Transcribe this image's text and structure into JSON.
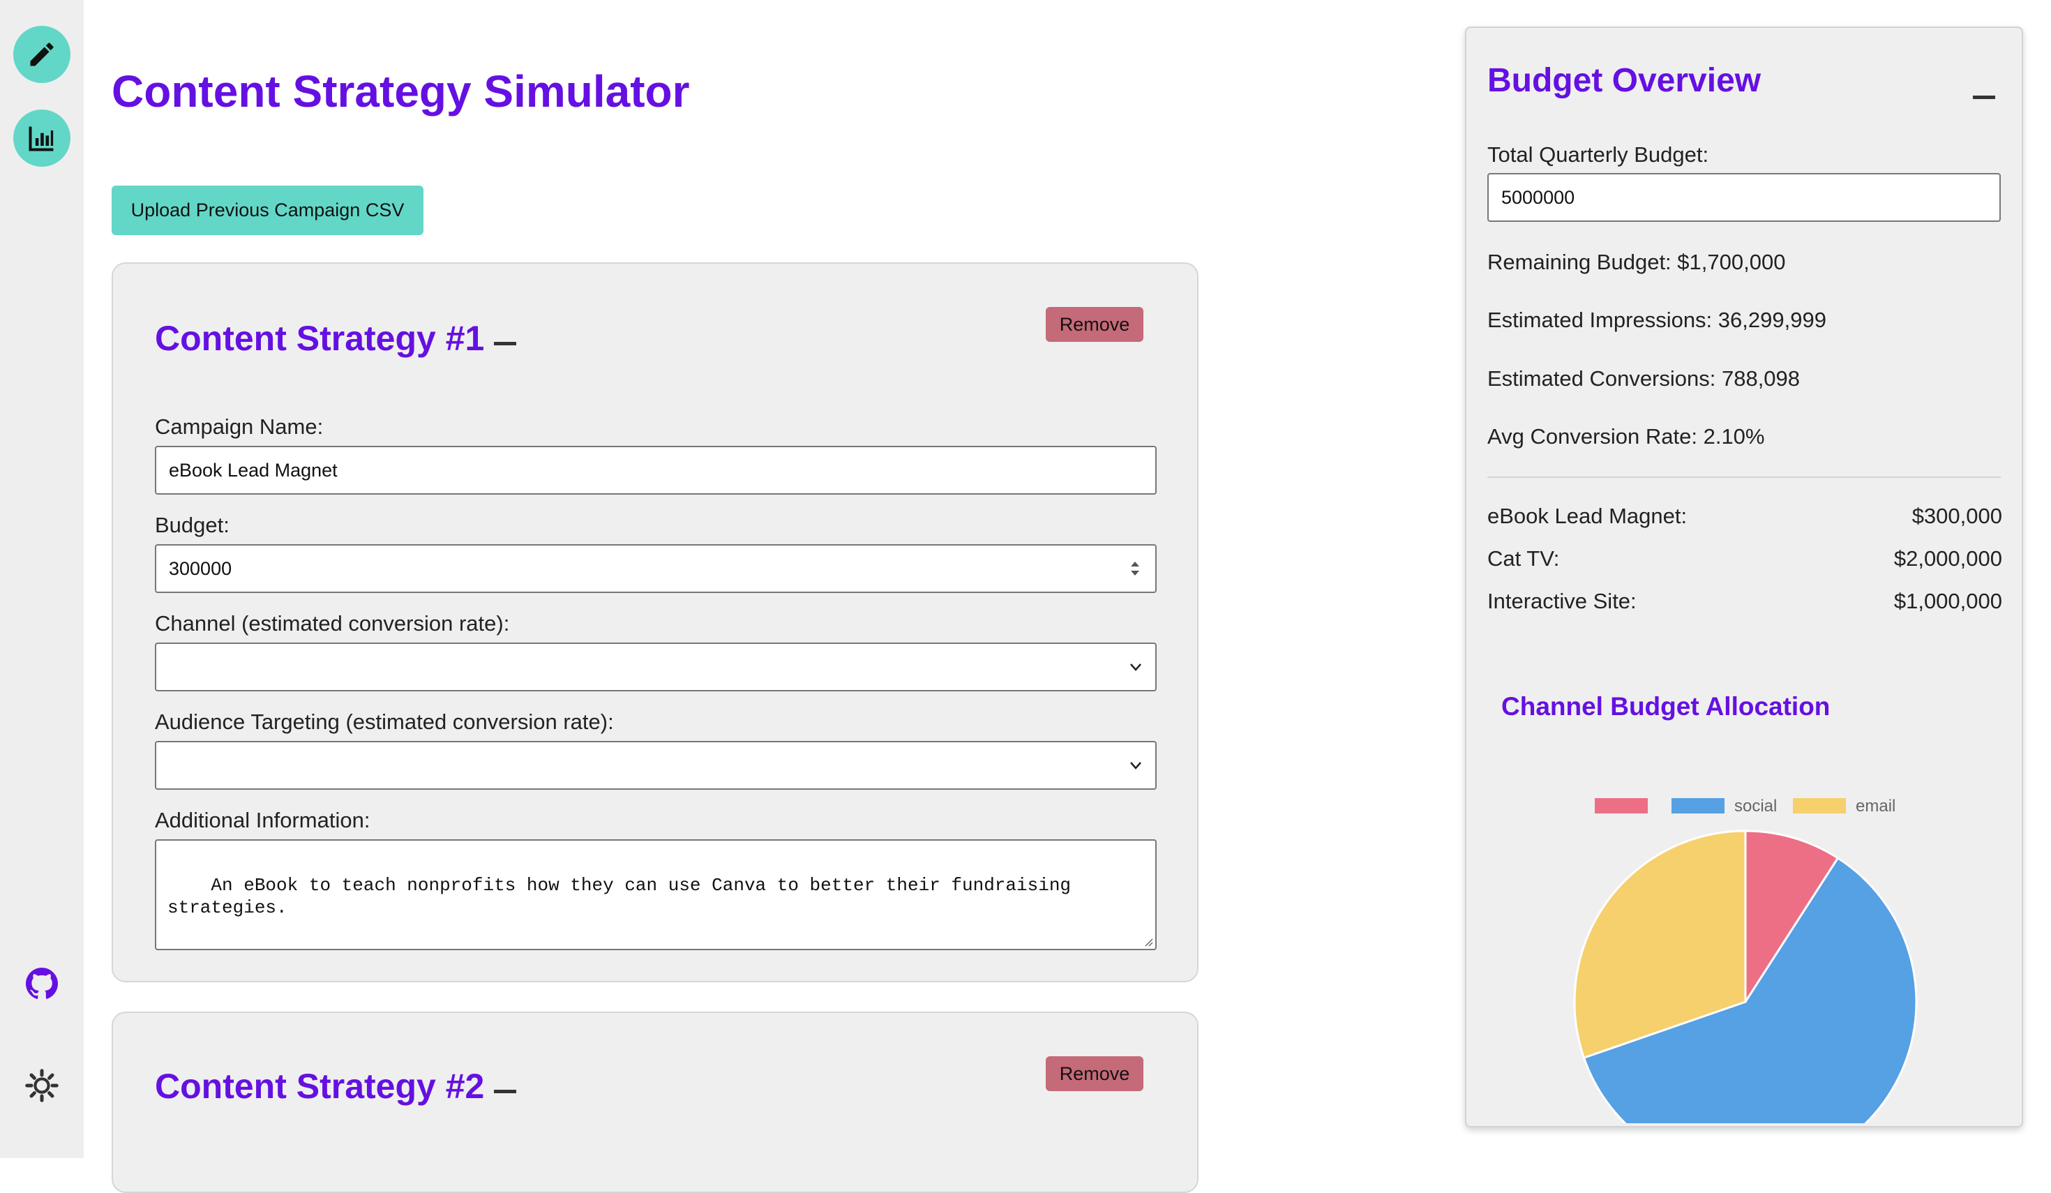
{
  "sidebar": {
    "items": [
      {
        "icon": "pencil-icon"
      },
      {
        "icon": "bar-chart-icon"
      },
      {
        "icon": "github-icon"
      },
      {
        "icon": "sun-icon"
      }
    ]
  },
  "page": {
    "title": "Content Strategy Simulator",
    "upload_label": "Upload Previous Campaign CSV"
  },
  "strategies": [
    {
      "title": "Content Strategy #1",
      "remove_label": "Remove",
      "campaign_name_label": "Campaign Name:",
      "campaign_name": "eBook Lead Magnet",
      "budget_label": "Budget:",
      "budget": "300000",
      "channel_label": "Channel (estimated conversion rate):",
      "channel_value": "",
      "audience_label": "Audience Targeting (estimated conversion rate):",
      "audience_value": "",
      "info_label": "Additional Information:",
      "info": "An eBook to teach nonprofits how they can use Canva to better their fundraising\nstrategies."
    },
    {
      "title": "Content Strategy #2",
      "remove_label": "Remove"
    }
  ],
  "overview": {
    "title": "Budget Overview",
    "total_label": "Total Quarterly Budget:",
    "total_value": "5000000",
    "remaining": "Remaining Budget: $1,700,000",
    "impressions": "Estimated Impressions: 36,299,999",
    "conversions": "Estimated Conversions: 788,098",
    "avg_rate": "Avg Conversion Rate: 2.10%",
    "allocations": [
      {
        "name": "eBook Lead Magnet:",
        "amount": "$300,000"
      },
      {
        "name": "Cat TV:",
        "amount": "$2,000,000"
      },
      {
        "name": "Interactive Site:",
        "amount": "$1,000,000"
      }
    ]
  },
  "chart_data": {
    "type": "pie",
    "title": "Channel Budget Allocation",
    "series": [
      {
        "name": "",
        "value": 300000,
        "color": "#ec6f86"
      },
      {
        "name": "social",
        "value": 2000000,
        "color": "#56a0e4"
      },
      {
        "name": "email",
        "value": 1000000,
        "color": "#f6d06d"
      }
    ],
    "legend_position": "top"
  }
}
